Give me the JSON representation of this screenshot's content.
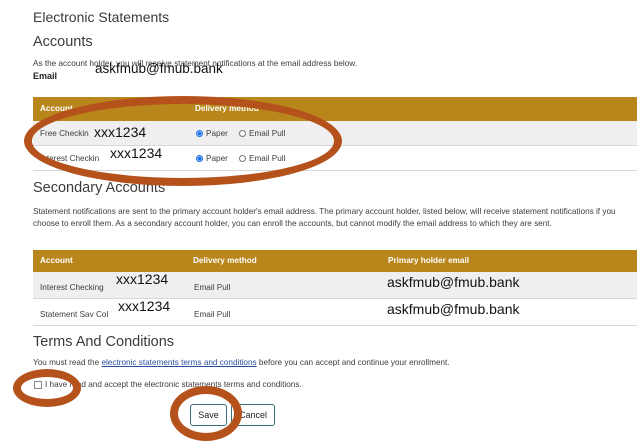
{
  "page_title": "Electronic Statements",
  "accounts": {
    "heading": "Accounts",
    "notice": "As the account holder, you will receive statement notifications at the email address below.",
    "email_label": "Email",
    "email_value": "askfmub@fmub.bank",
    "table_headers": [
      "Account",
      "Delivery method"
    ],
    "rows": [
      {
        "account_partial": "Free Checkin",
        "account_number": "xxx1234",
        "options": [
          "Paper",
          "Email Pull"
        ],
        "selected": "Paper"
      },
      {
        "account_partial": "Interest Checkin",
        "account_number": "xxx1234",
        "options": [
          "Paper",
          "Email Pull"
        ],
        "selected": "Paper"
      }
    ]
  },
  "secondary": {
    "heading": "Secondary Accounts",
    "notice": "Statement notifications are sent to the primary account holder's email address. The primary account holder, listed below, will receive statement notifications if you choose to enroll them. As a secondary account holder, you can enroll the accounts, but cannot modify the email address to which they are sent.",
    "table_headers": [
      "Account",
      "Delivery method",
      "Primary holder email"
    ],
    "rows": [
      {
        "account": "Interest Checking",
        "account_number": "xxx1234",
        "delivery": "Email Pull",
        "email": "askfmub@fmub.bank"
      },
      {
        "account": "Statement Sav Col",
        "account_number": "xxx1234",
        "delivery": "Email Pull",
        "email": "askfmub@fmub.bank"
      }
    ]
  },
  "terms": {
    "heading": "Terms And Conditions",
    "prefix": "You must read the ",
    "link": "electronic statements terms and conditions",
    "suffix": " before you can accept and continue your enrollment.",
    "checkbox_label": "I have read and accept the electronic statements terms and conditions."
  },
  "buttons": {
    "save": "Save",
    "cancel": "Cancel"
  },
  "colors": {
    "header_bg": "#b8861b",
    "annotation": "#b5521c",
    "accent": "#1a73e8"
  }
}
